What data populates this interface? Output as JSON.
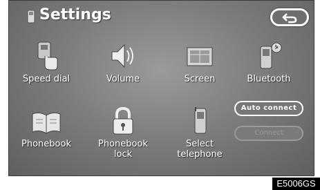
{
  "header": {
    "title": "Settings"
  },
  "menu": {
    "speed_dial": "Speed dial",
    "volume": "Volume",
    "screen": "Screen",
    "bluetooth": "Bluetooth",
    "phonebook": "Phonebook",
    "phonebook_lock": "Phonebook\nlock",
    "select_telephone": "Select\ntelephone"
  },
  "side_buttons": {
    "auto_connect": "Auto connect",
    "connect": "Connect"
  },
  "figure_code": "E5006GS",
  "icons": [
    "phone-icon",
    "back-arrow-icon",
    "speed-dial-icon",
    "volume-icon",
    "screen-icon",
    "bluetooth-phone-icon",
    "phonebook-icon",
    "lock-icon",
    "telephone-icon"
  ]
}
